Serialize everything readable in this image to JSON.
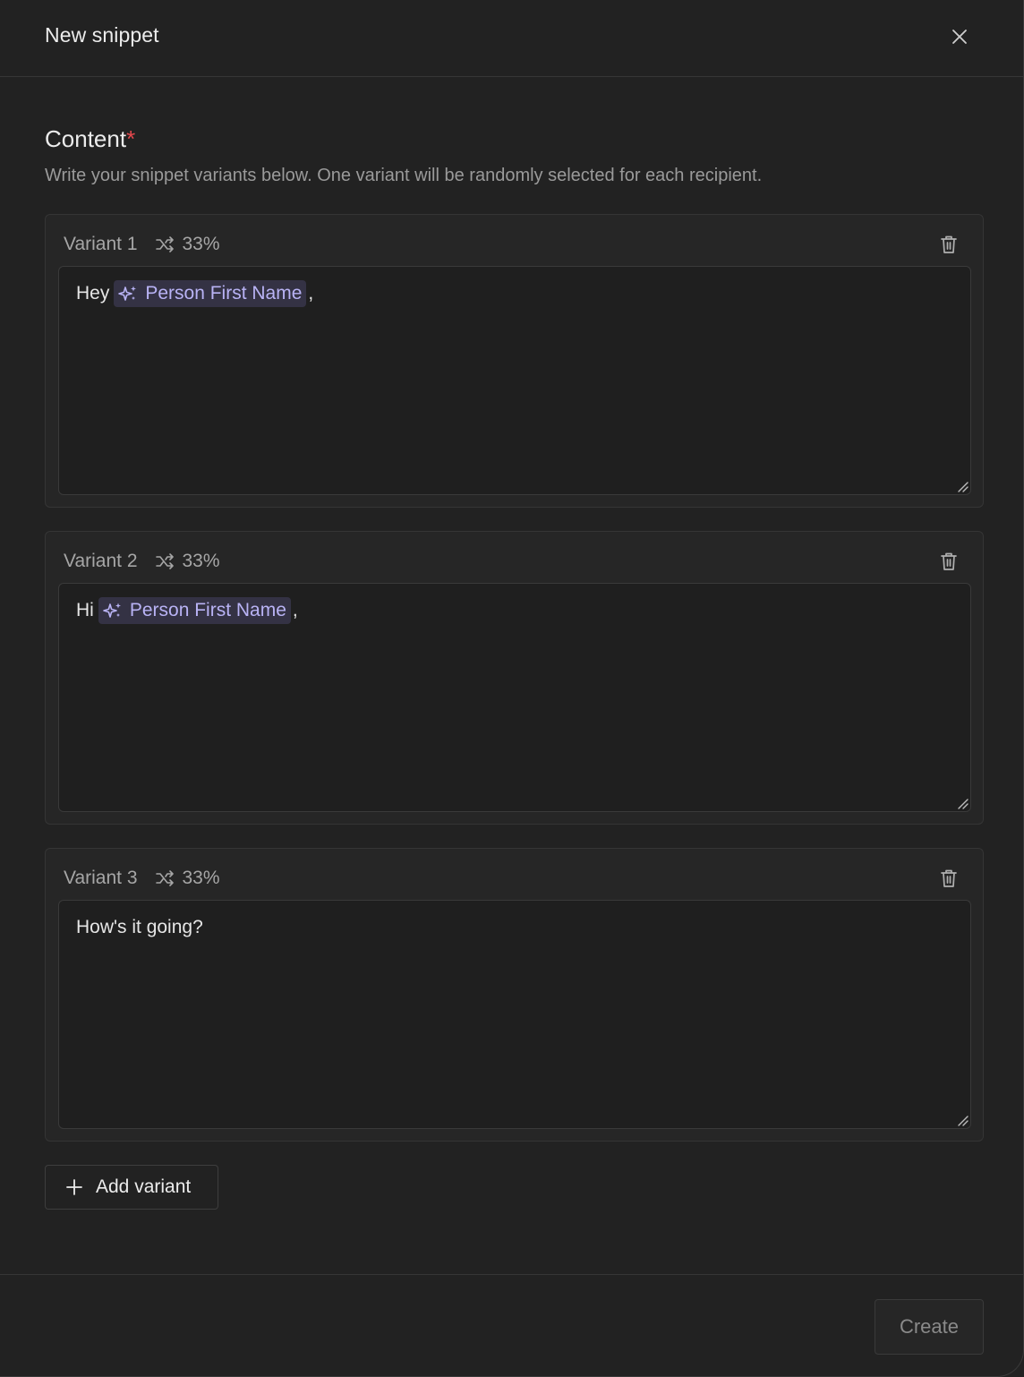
{
  "header": {
    "title": "New snippet"
  },
  "content": {
    "label": "Content",
    "required_mark": "*",
    "description": "Write your snippet variants below. One variant will be randomly selected for each recipient."
  },
  "variants": [
    {
      "label": "Variant 1",
      "weight": "33%",
      "text_before": "Hey",
      "variable": "Person First Name",
      "text_after": ","
    },
    {
      "label": "Variant 2",
      "weight": "33%",
      "text_before": "Hi",
      "variable": "Person First Name",
      "text_after": ","
    },
    {
      "label": "Variant 3",
      "weight": "33%",
      "text_before": "How's it going?"
    }
  ],
  "add_variant": {
    "label": "Add variant"
  },
  "footer": {
    "create_label": "Create"
  },
  "colors": {
    "accent_chip_bg": "#343244",
    "accent_chip_text": "#b9b3f5",
    "required": "#e5484d"
  }
}
